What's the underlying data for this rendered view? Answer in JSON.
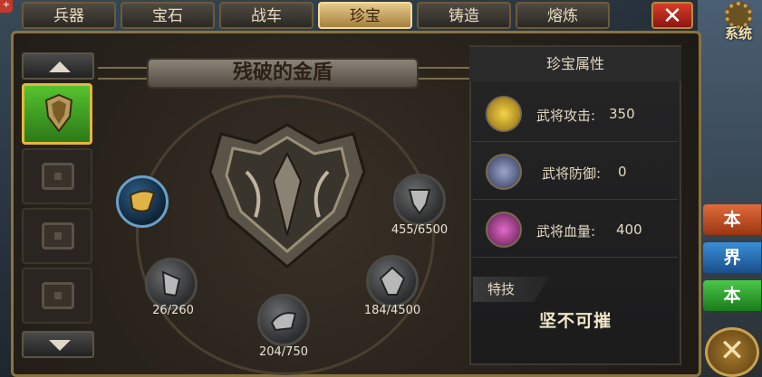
{
  "tabs": [
    {
      "label": "兵器",
      "active": false
    },
    {
      "label": "宝石",
      "active": false
    },
    {
      "label": "战车",
      "active": false
    },
    {
      "label": "珍宝",
      "active": true
    },
    {
      "label": "铸造",
      "active": false
    },
    {
      "label": "熔炼",
      "active": false
    }
  ],
  "close_label": "✕",
  "system_label": "系统",
  "corner_badge": "+",
  "treasure": {
    "name": "残破的金盾",
    "pieces": [
      {
        "count": ""
      },
      {
        "count": "26/260"
      },
      {
        "count": "204/750"
      },
      {
        "count": "184/4500"
      },
      {
        "count": "455/6500"
      }
    ]
  },
  "attributes": {
    "title": "珍宝属性",
    "rows": [
      {
        "label": "武将攻击:",
        "value": "350",
        "icon": "sword-icon"
      },
      {
        "label": "武将防御:",
        "value": "0",
        "icon": "shield-icon"
      },
      {
        "label": "武将血量:",
        "value": "400",
        "icon": "heart-icon"
      }
    ],
    "skill_title": "特技",
    "skill_name": "坚不可摧"
  },
  "side_buttons": [
    "本",
    "界",
    "本"
  ],
  "colors": {
    "active_tab": "#e6c98a",
    "close_red": "#d83b2a",
    "selected_slot": "#56c22f",
    "frame_gold": "#8a7340"
  }
}
